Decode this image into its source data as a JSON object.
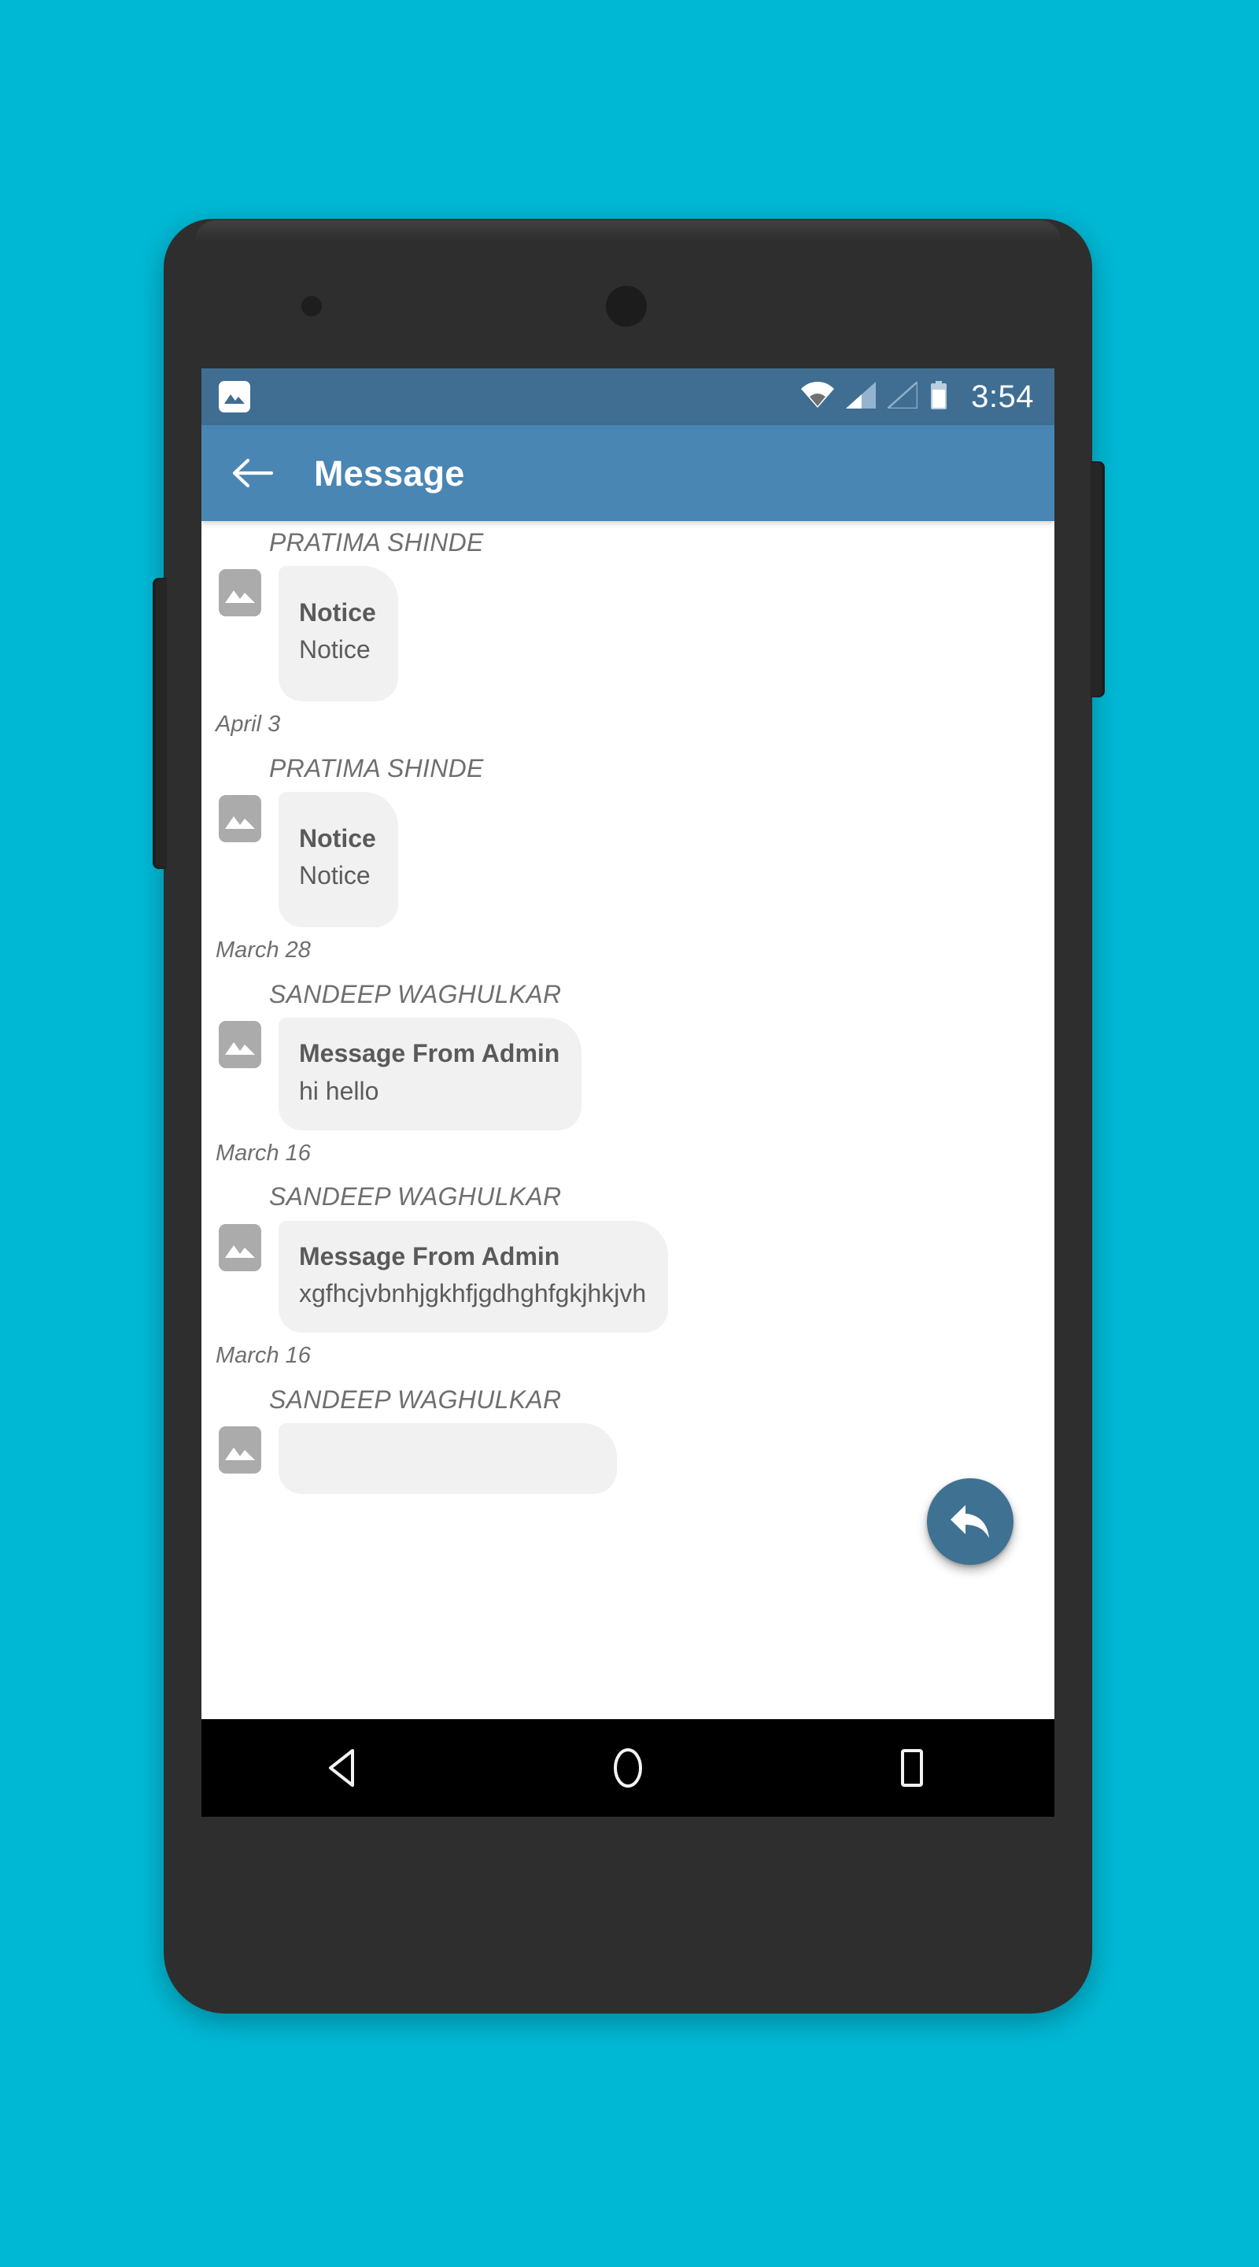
{
  "device": {
    "front_camera": "front-camera",
    "earpiece": "earpiece-sensor",
    "volume_button": "volume-rocker",
    "power_button": "power-button"
  },
  "status_bar": {
    "notification_icon": "image-placeholder-icon",
    "wifi_icon": "wifi-icon",
    "signal_icon_1": "signal-bars-icon",
    "signal_icon_2": "signal-bars-empty-icon",
    "battery_icon": "battery-icon",
    "time": "3:54",
    "background_color": "#3f6e92"
  },
  "app_bar": {
    "back_icon": "back-arrow-icon",
    "title": "Message",
    "background_color": "#4a86b4",
    "text_color": "#ffffff"
  },
  "messages": [
    {
      "sender": "PRATIMA SHINDE",
      "avatar_icon": "image-placeholder-icon",
      "title": "Notice",
      "body": "Notice",
      "date": "April 3",
      "tall": true
    },
    {
      "sender": "PRATIMA SHINDE",
      "avatar_icon": "image-placeholder-icon",
      "title": "Notice",
      "body": "Notice",
      "date": "March 28",
      "tall": true
    },
    {
      "sender": "SANDEEP WAGHULKAR",
      "avatar_icon": "image-placeholder-icon",
      "title": "Message From Admin",
      "body": "hi hello",
      "date": "March 16",
      "tall": false
    },
    {
      "sender": "SANDEEP WAGHULKAR",
      "avatar_icon": "image-placeholder-icon",
      "title": "Message From Admin",
      "body": "xgfhcjvbnhjgkhfjgdhghfgkjhkjvh",
      "date": "March 16",
      "tall": false
    },
    {
      "sender": "SANDEEP WAGHULKAR",
      "avatar_icon": "image-placeholder-icon",
      "title": "",
      "body": "",
      "date": "",
      "tall": false
    }
  ],
  "fab": {
    "icon": "reply-arrow-icon",
    "color": "#3f7193"
  },
  "nav_bar": {
    "back_icon": "nav-back-triangle-icon",
    "home_icon": "nav-home-circle-icon",
    "recents_icon": "nav-recents-square-icon",
    "background_color": "#000000"
  },
  "page": {
    "background_color": "#00b8d4"
  }
}
